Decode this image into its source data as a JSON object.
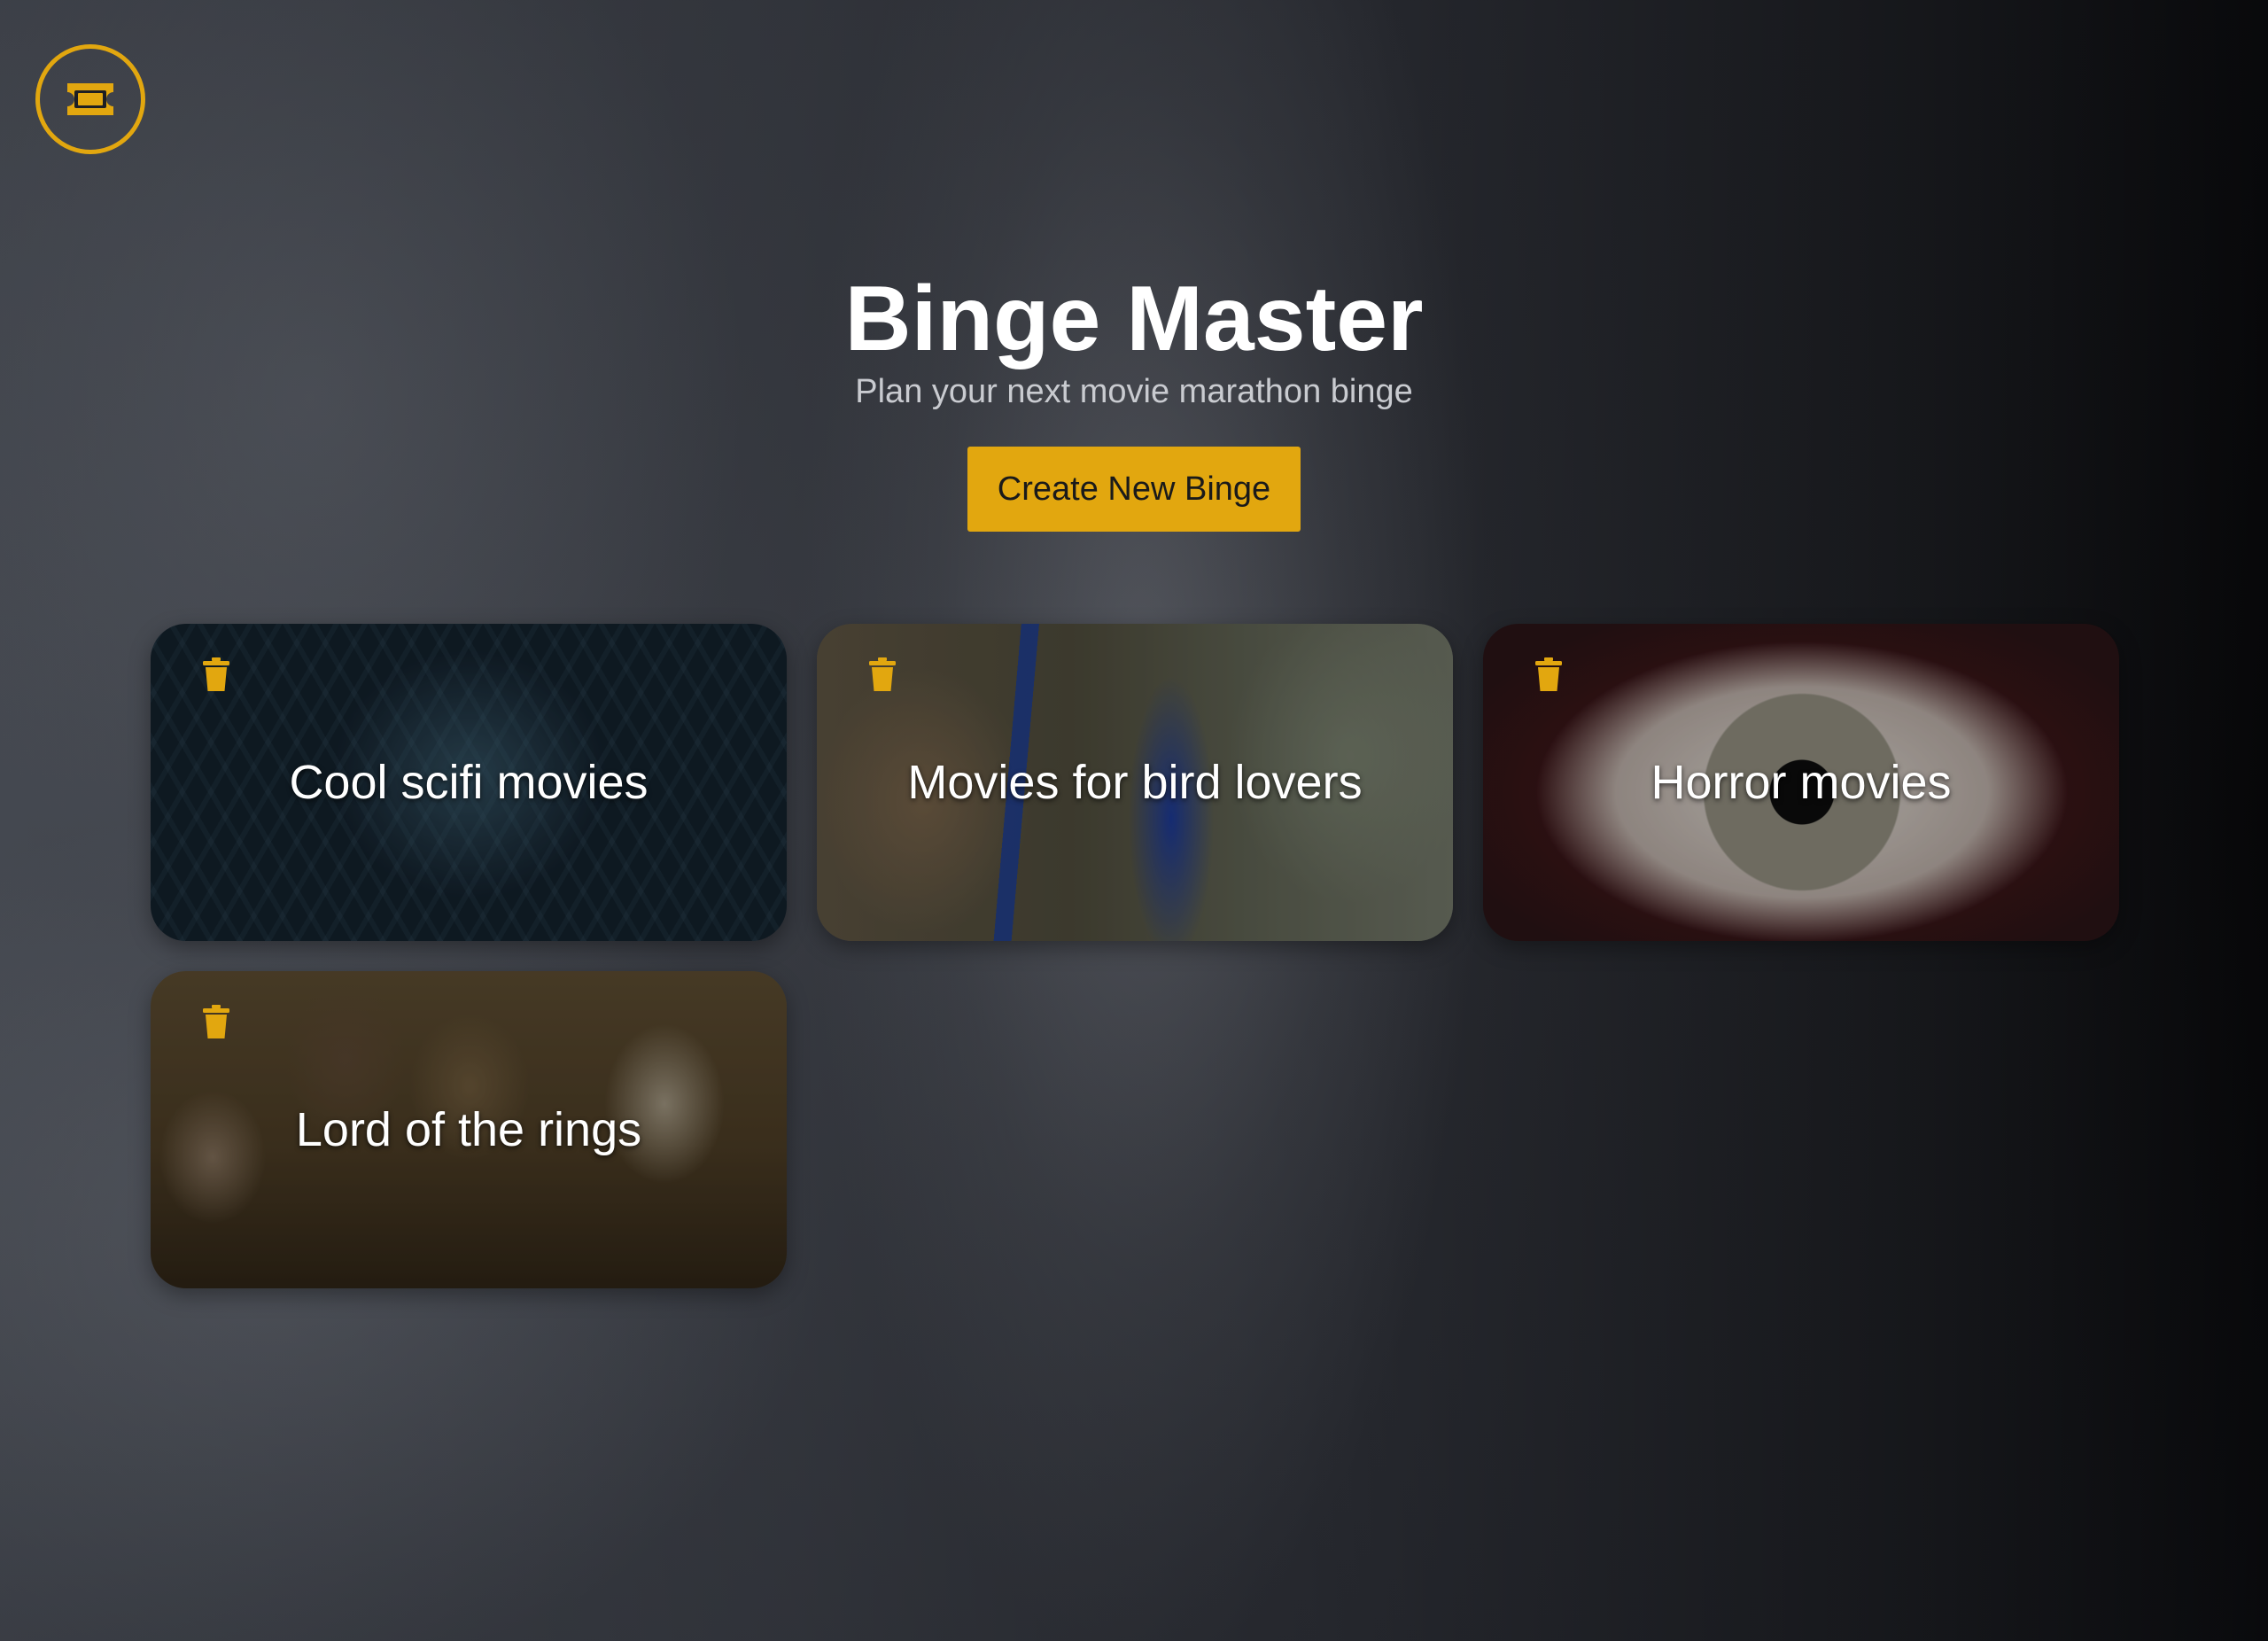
{
  "app": {
    "title": "Binge Master",
    "subtitle": "Plan your next movie marathon binge",
    "logo_icon": "ticket-icon",
    "accent_color": "#e2a70f"
  },
  "actions": {
    "create_label": "Create New Binge"
  },
  "binges": [
    {
      "title": "Cool scifi movies",
      "delete_icon": "trash-icon"
    },
    {
      "title": "Movies for bird lovers",
      "delete_icon": "trash-icon"
    },
    {
      "title": "Horror movies",
      "delete_icon": "trash-icon"
    },
    {
      "title": "Lord of the rings",
      "delete_icon": "trash-icon"
    }
  ]
}
